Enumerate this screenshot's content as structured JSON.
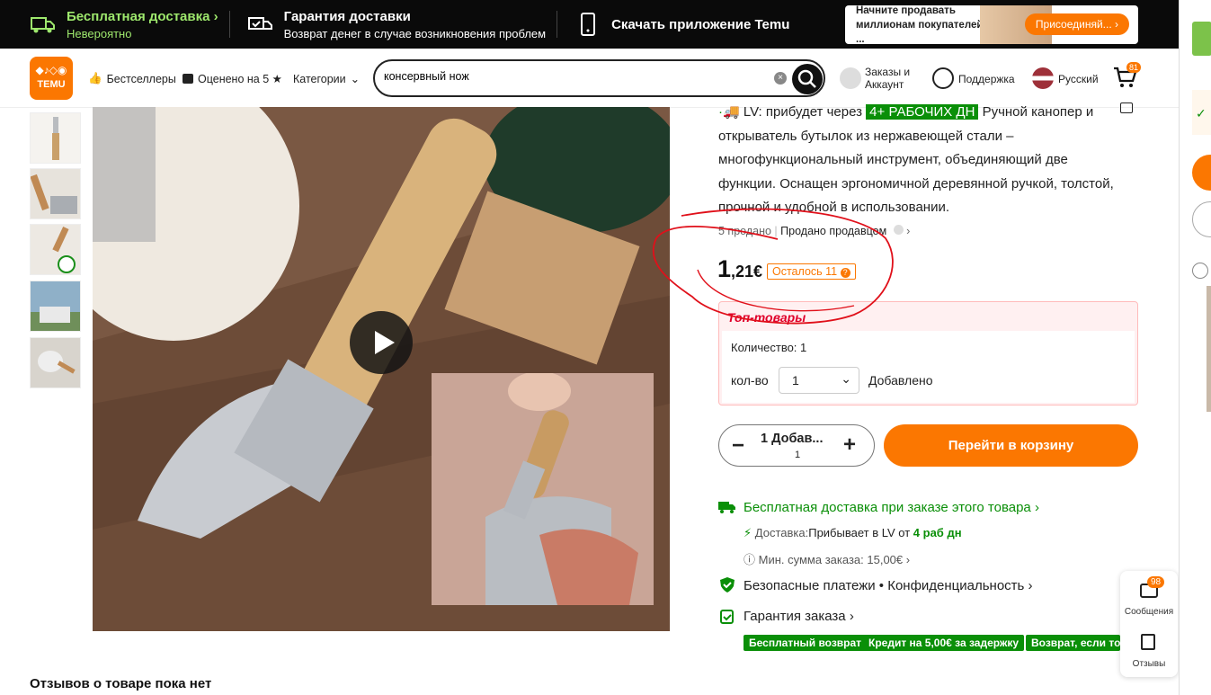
{
  "promo": {
    "free_shipping_title": "Бесплатная доставка",
    "free_shipping_sub": "Невероятно",
    "guarantee_title": "Гарантия доставки",
    "guarantee_sub": "Возврат денег в случае возникновения проблем",
    "app_title": "Скачать приложение Temu",
    "seller_line1": "Начните продавать",
    "seller_line2": "миллионам покупателей ...",
    "seller_button": "Присоединяй... ›"
  },
  "header": {
    "logo_text": "TEMU",
    "nav": [
      "Бестселлеры",
      "Оценено на 5 ★",
      "Категории"
    ],
    "search_value": "консервный нож",
    "orders": "Заказы и Аккаунт",
    "support": "Поддержка",
    "language": "Русский",
    "cart_count": "81"
  },
  "product": {
    "delivery_prefix": "LV: прибудет через",
    "delivery_days": "4+ РАБОЧИХ ДН",
    "description": "Ручной канопер и открыватель бутылок из нержавеющей стали – многофункциональный инструмент, объединяющий две функции. Оснащен эргономичной деревянной ручкой, толстой, прочной и удобной в использовании.",
    "sold": "5 продано",
    "sold_by": "Продано продавцом",
    "price_int": "1",
    "price_frac": ",21€",
    "stock_left": "Осталось 11",
    "top_title": "Топ-товары",
    "qty_line": "Количество: 1",
    "qty_label": "кол-во",
    "qty_value": "1",
    "qty_added": "Добавлено",
    "stepper_label": "1 Добав...",
    "stepper_count": "1",
    "cart_button": "Перейти в корзину",
    "ship_title": "Бесплатная доставка при заказе этого товара",
    "delivery_label": "Доставка:",
    "delivery_value": "Прибывает в LV от",
    "delivery_days_short": "4 раб дн",
    "min_order": "Мин. сумма заказа: 15,00€",
    "secure": "Безопасные платежи • Конфиденциальность",
    "guarantee": "Гарантия заказа",
    "pills": [
      "Бесплатный возврат",
      "Кредит на 5,00€ за задержку",
      "Возврат, если то"
    ]
  },
  "float": {
    "messages": "Сообщения",
    "messages_count": "98",
    "reviews": "Отзывы"
  },
  "reviews_title": "Отзывов о товаре пока нет",
  "colors": {
    "accent": "#fb7701",
    "green": "#0a8f08",
    "promo_green": "#9ee86d",
    "annotation": "#e0101a"
  }
}
